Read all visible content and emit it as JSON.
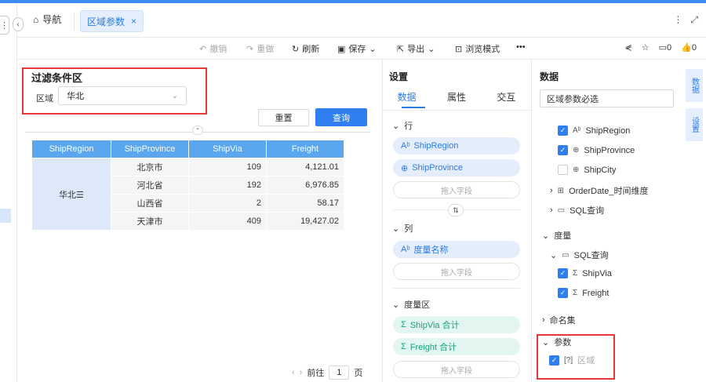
{
  "tabs": {
    "nav_label": "导航",
    "active_tab_label": "区域参数",
    "close_glyph": "×"
  },
  "window": {
    "more": "⋮",
    "expand": "⤢"
  },
  "toolbar": {
    "undo": "撤销",
    "redo": "重做",
    "refresh": "刷新",
    "save": "保存",
    "export": "导出",
    "preview": "浏览模式",
    "more": "•••",
    "comments": "0",
    "likes": "0"
  },
  "filter": {
    "title": "过滤条件区",
    "region_label": "区域",
    "region_value": "华北"
  },
  "actions": {
    "reset": "重置",
    "query": "查询"
  },
  "table": {
    "headers": [
      "ShipRegion",
      "ShipProvince",
      "ShipVia",
      "Freight"
    ],
    "region": "华北☰",
    "rows": [
      {
        "province": "北京市",
        "shipvia": "109",
        "freight": "4,121.01"
      },
      {
        "province": "河北省",
        "shipvia": "192",
        "freight": "6,976.85"
      },
      {
        "province": "山西省",
        "shipvia": "2",
        "freight": "58.17"
      },
      {
        "province": "天津市",
        "shipvia": "409",
        "freight": "19,427.02"
      }
    ]
  },
  "pager": {
    "goto": "前往",
    "page": "1",
    "page_suffix": "页"
  },
  "settings": {
    "title": "设置",
    "tabs": [
      "数据",
      "属性",
      "交互"
    ],
    "row_label": "行",
    "col_label": "列",
    "measure_label": "度量区",
    "row_fields": [
      "ShipRegion",
      "ShipProvince"
    ],
    "col_fields": [
      "度量名称"
    ],
    "measure_fields": [
      "ShipVia 合计",
      "Freight 合计"
    ],
    "drop_hint": "拖入字段"
  },
  "data_panel": {
    "title": "数据",
    "search_value": "区域参数必选",
    "dimension_items": [
      {
        "label": "ShipRegion",
        "checked": true
      },
      {
        "label": "ShipProvince",
        "checked": true
      },
      {
        "label": "ShipCity",
        "checked": false
      }
    ],
    "folders": [
      "OrderDate_时间维度",
      "SQL查询"
    ],
    "measure_header": "度量",
    "measure_folder": "SQL查询",
    "measure_items": [
      "ShipVia",
      "Freight"
    ],
    "named_sets": "命名集",
    "params_header": "参数",
    "param_item": "区域"
  },
  "side_tabs": [
    "数据",
    "设置"
  ]
}
